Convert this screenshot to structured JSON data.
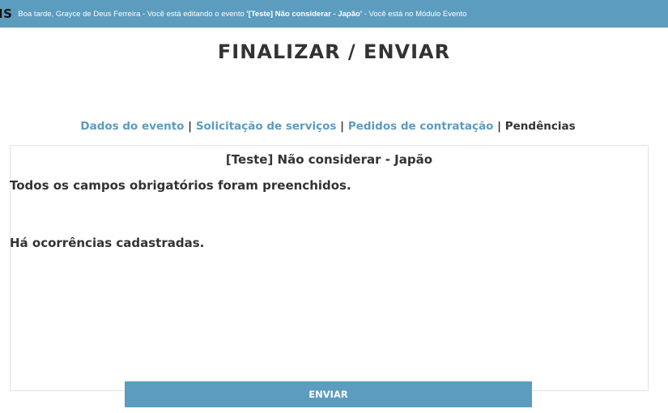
{
  "header": {
    "logo": "IS",
    "greeting_prefix": "Boa tarde, Grayce de Deus Ferreira - Você está editando o evento ",
    "event_quoted": "'[Teste] Não considerar - Japão'",
    "greeting_suffix": " - Você está no Módulo Evento"
  },
  "page": {
    "title": "FINALIZAR / ENVIAR"
  },
  "nav": {
    "items": [
      {
        "label": "Dados do evento"
      },
      {
        "label": "Solicitação de serviços"
      },
      {
        "label": "Pedidos de contratação"
      },
      {
        "label": "Pendências"
      }
    ],
    "separator": "|"
  },
  "main": {
    "event_name": "[Teste] Não considerar - Japão",
    "messages": [
      "Todos os campos obrigatórios foram preenchidos.",
      "Há ocorrências cadastradas."
    ],
    "send_label": "ENVIAR"
  },
  "colors": {
    "accent": "#5b9cbf",
    "text": "#333333"
  }
}
